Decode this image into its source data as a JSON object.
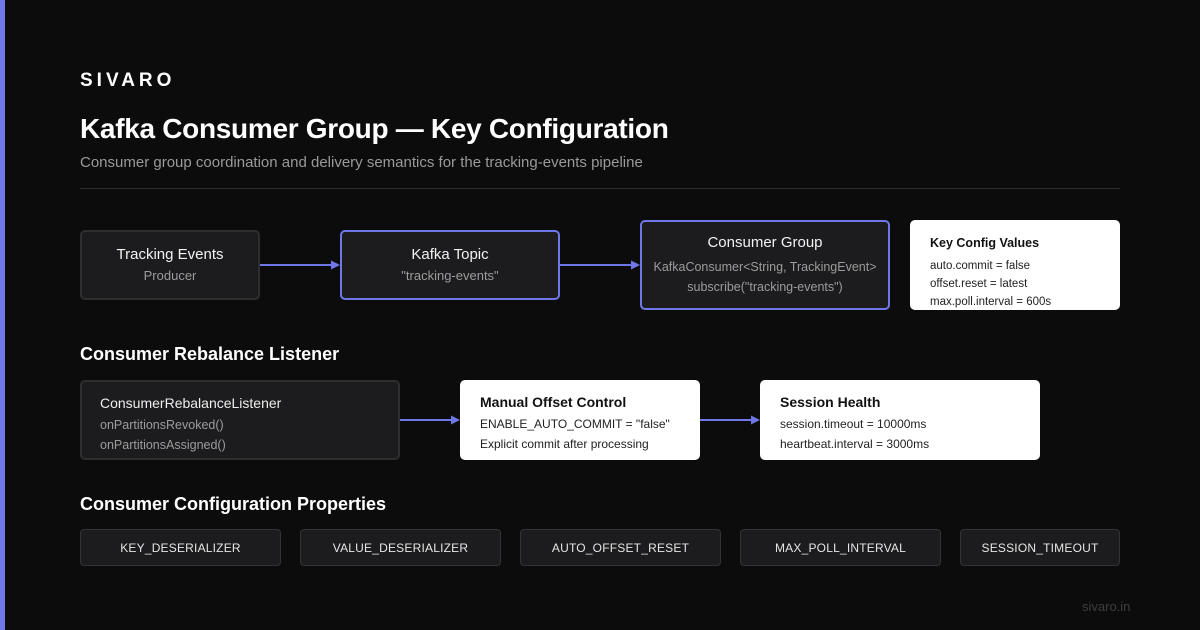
{
  "brand": "SIVARO",
  "title": "Kafka Consumer Group — Key Configuration",
  "subtitle": "Consumer group coordination and delivery semantics for the tracking-events pipeline",
  "colors": {
    "background": "#0c0c0c",
    "accent": "#6f78e6",
    "card_light": "#ffffff",
    "card_dark": "#1c1c1e"
  },
  "flow": {
    "producer": {
      "title": "Tracking Events",
      "sub": "Producer"
    },
    "topic": {
      "title": "Kafka Topic",
      "sub": "\"tracking-events\""
    },
    "consumer_group": {
      "title": "Consumer Group",
      "line1": "KafkaConsumer<String, TrackingEvent>",
      "line2": "subscribe(\"tracking-events\")"
    },
    "key_config": {
      "title": "Key Config Values",
      "lines": [
        "auto.commit = false",
        "offset.reset = latest",
        "max.poll.interval = 600s"
      ]
    }
  },
  "rebalance": {
    "heading": "Consumer Rebalance Listener",
    "listener": {
      "title": "ConsumerRebalanceListener",
      "lines": [
        "onPartitionsRevoked()",
        "onPartitionsAssigned()"
      ]
    },
    "manual_offset": {
      "title": "Manual Offset Control",
      "lines": [
        "ENABLE_AUTO_COMMIT = \"false\"",
        "Explicit commit after processing"
      ]
    },
    "session_health": {
      "title": "Session Health",
      "lines": [
        "session.timeout = 10000ms",
        "heartbeat.interval = 3000ms"
      ]
    }
  },
  "properties": {
    "heading": "Consumer Configuration Properties",
    "items": [
      "KEY_DESERIALIZER",
      "VALUE_DESERIALIZER",
      "AUTO_OFFSET_RESET",
      "MAX_POLL_INTERVAL",
      "SESSION_TIMEOUT"
    ]
  },
  "footer": "sivaro.in"
}
